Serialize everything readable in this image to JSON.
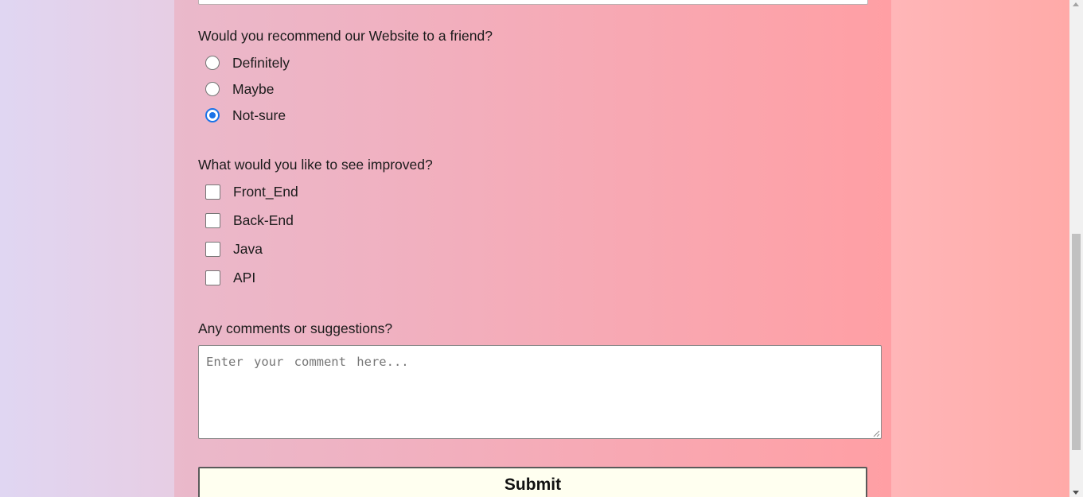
{
  "survey": {
    "recommend": {
      "question": "Would you recommend our Website to a friend?",
      "options": [
        {
          "label": "Definitely",
          "checked": false
        },
        {
          "label": "Maybe",
          "checked": false
        },
        {
          "label": "Not-sure",
          "checked": true
        }
      ]
    },
    "improvements": {
      "question": "What would you like to see improved?",
      "options": [
        {
          "label": "Front_End",
          "checked": false
        },
        {
          "label": "Back-End",
          "checked": false
        },
        {
          "label": "Java",
          "checked": false
        },
        {
          "label": "API",
          "checked": false
        }
      ]
    },
    "comments": {
      "question": "Any comments or suggestions?",
      "placeholder": "Enter your comment here...",
      "value": ""
    },
    "submit_label": "Submit"
  },
  "colors": {
    "radio_accent": "#1a73e8",
    "submit_background": "#fffff0",
    "panel_gradient_start": "#eab9cb",
    "panel_gradient_end": "#ff9fa4"
  },
  "scrollbar": {
    "position_fraction": 0.85
  }
}
